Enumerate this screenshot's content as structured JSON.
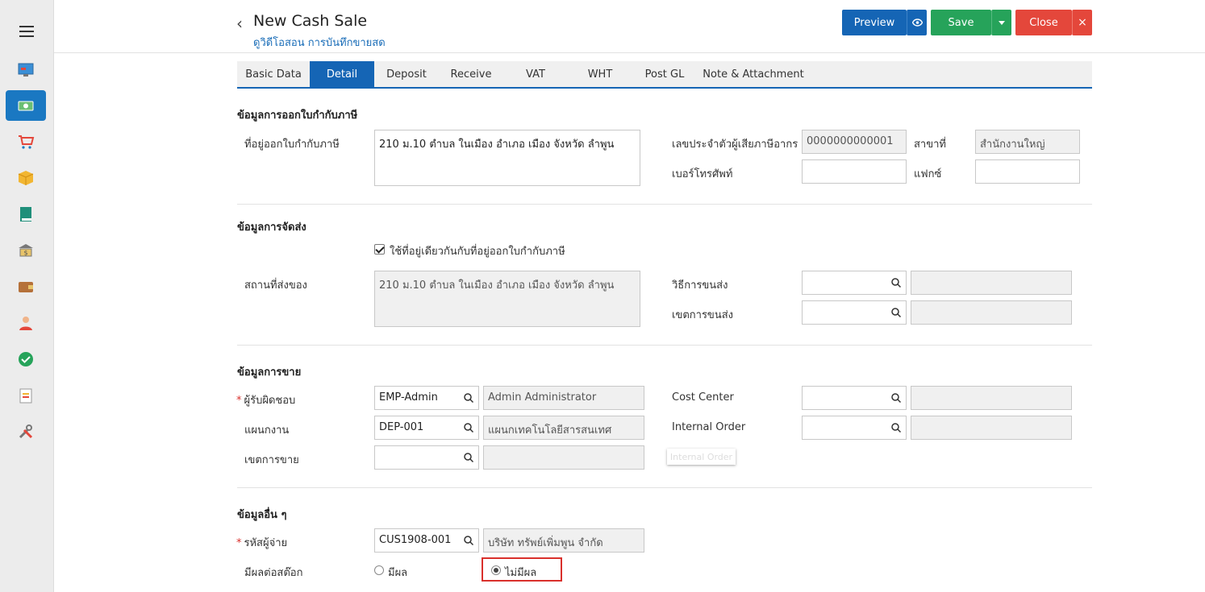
{
  "header": {
    "title": "New Cash Sale",
    "subtitle": "ดูวิดีโอสอน การบันทึกขายสด",
    "preview_label": "Preview",
    "save_label": "Save",
    "close_label": "Close",
    "close_x": "×"
  },
  "tabs": [
    "Basic Data",
    "Detail",
    "Deposit",
    "Receive",
    "VAT",
    "WHT",
    "Post GL",
    "Note & Attachment"
  ],
  "tax_section": {
    "title": "ข้อมูลการออกใบกำกับภาษี",
    "address_label": "ที่อยู่ออกใบกำกับภาษี",
    "address_value": "210 ม.10 ตำบล ในเมือง อำเภอ เมือง จังหวัด ลำพูน",
    "tax_id_label": "เลขประจำตัวผู้เสียภาษีอากร",
    "tax_id_value": "0000000000001",
    "branch_label": "สาขาที่",
    "branch_value": "สำนักงานใหญ่",
    "phone_label": "เบอร์โทรศัพท์",
    "phone_value": "",
    "fax_label": "แฟกซ์",
    "fax_value": ""
  },
  "delivery_section": {
    "title": "ข้อมูลการจัดส่ง",
    "same_address_label": "ใช้ที่อยู่เดียวกันกับที่อยู่ออกใบกำกับภาษี",
    "ship_address_label": "สถานที่ส่งของ",
    "ship_address_value": "210 ม.10 ตำบล ในเมือง อำเภอ เมือง จังหวัด ลำพูน",
    "ship_method_label": "วิธีการขนส่ง",
    "ship_zone_label": "เขตการขนส่ง"
  },
  "sales_section": {
    "title": "ข้อมูลการขาย",
    "responsible_label": "ผู้รับผิดชอบ",
    "responsible_code": "EMP-Admin",
    "responsible_name": "Admin Administrator",
    "department_label": "แผนกงาน",
    "department_code": "DEP-001",
    "department_name": "แผนกเทคโนโลยีสารสนเทศ",
    "sales_zone_label": "เขตการขาย",
    "cost_center_label": "Cost Center",
    "internal_order_label": "Internal Order",
    "tooltip_ghost": "Internal Order"
  },
  "other_section": {
    "title": "ข้อมูลอื่น ๆ",
    "payer_label": "รหัสผู้จ่าย",
    "payer_code": "CUS1908-001",
    "payer_name": "บริษัท ทรัพย์เพิ่มพูน จำกัด",
    "stock_effect_label": "มีผลต่อสต๊อก",
    "option_yes": "มีผล",
    "option_no": "ไม่มีผล"
  },
  "colors": {
    "primary": "#1565b5",
    "success": "#26a35a",
    "danger": "#e4473b",
    "sidebar_active": "#1a78c2"
  }
}
